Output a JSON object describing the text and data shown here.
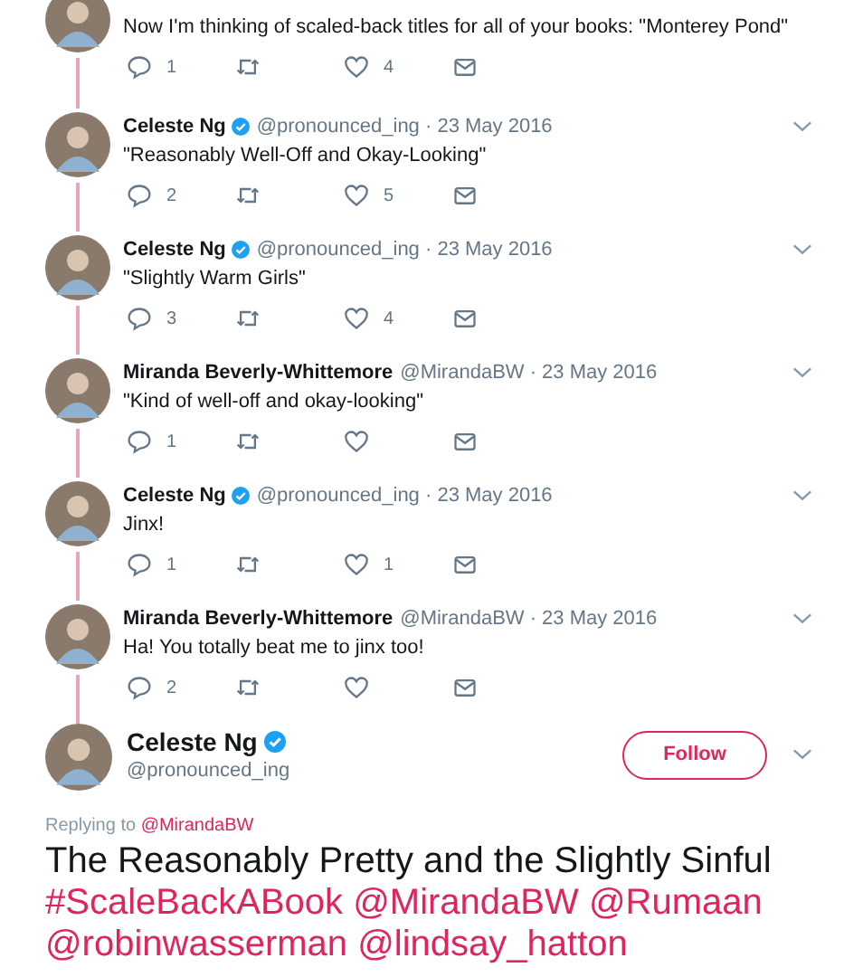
{
  "thread": [
    {
      "text": "Now I'm thinking of scaled-back titles for all of your books: \"Monterey Pond\"",
      "replies": "1",
      "likes": "4"
    },
    {
      "author": "Celeste Ng",
      "verified": true,
      "handle": "@pronounced_ing ·",
      "date": "23 May 2016",
      "text": "\"Reasonably Well-Off and Okay-Looking\"",
      "replies": "2",
      "likes": "5"
    },
    {
      "author": "Celeste Ng",
      "verified": true,
      "handle": "@pronounced_ing ·",
      "date": "23 May 2016",
      "text": "\"Slightly Warm Girls\"",
      "replies": "3",
      "likes": "4"
    },
    {
      "author": "Miranda Beverly-Whittemore",
      "verified": false,
      "handle": "@MirandaBW ·",
      "date": "23 May 2016",
      "text": "\"Kind of well-off and okay-looking\"",
      "replies": "1"
    },
    {
      "author": "Celeste Ng",
      "verified": true,
      "handle": "@pronounced_ing ·",
      "date": "23 May 2016",
      "text": "Jinx!",
      "replies": "1",
      "likes": "1"
    },
    {
      "author": "Miranda Beverly-Whittemore",
      "verified": false,
      "handle": "@MirandaBW ·",
      "date": "23 May 2016",
      "text": "Ha! You totally beat me to jinx too!",
      "replies": "2"
    }
  ],
  "main_tweet": {
    "author": "Celeste Ng",
    "verified": true,
    "handle": "@pronounced_ing",
    "follow_button": "Follow",
    "replying_label": "Replying to",
    "replying_to": "@MirandaBW",
    "text": "The Reasonably Pretty and the Slightly Sinful",
    "links": [
      "#ScaleBackABook",
      "@MirandaBW",
      "@Rumaan",
      "@robinwasserman",
      "@lindsay_hatton"
    ]
  }
}
